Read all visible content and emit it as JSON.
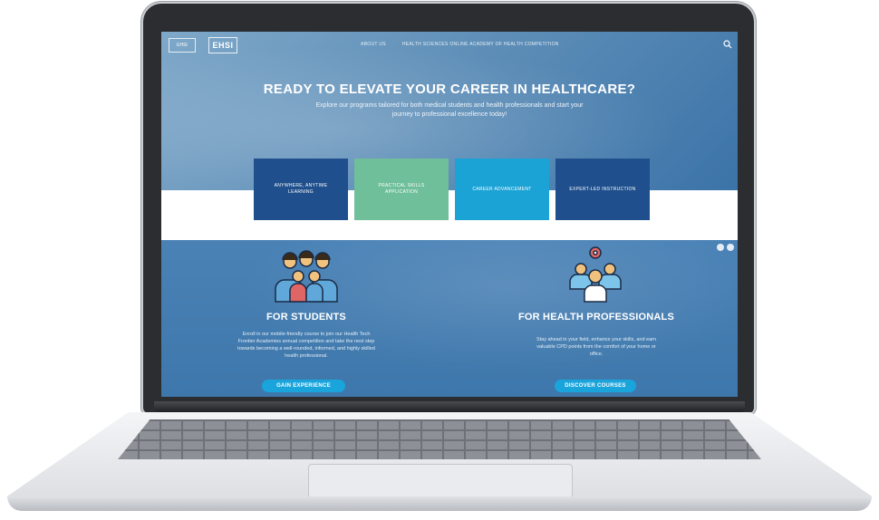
{
  "nav": {
    "logo_left": "EHSI",
    "logo_right": "EHSI",
    "links": [
      "ABOUT US",
      "HEALTH SCIENCES ONLINE ACADEMY OF HEALTH COMPETITION"
    ]
  },
  "hero": {
    "title": "READY TO ELEVATE YOUR CAREER IN HEALTHCARE?",
    "subtitle": "Explore our programs tailored for both medical students and health professionals and start your journey to professional excellence today!"
  },
  "tiles": [
    {
      "label": "ANYWHERE, ANYTIME LEARNING",
      "color": "#1f4f8c"
    },
    {
      "label": "PRACTICAL SKILLS APPLICATION",
      "color": "#6fbf9a"
    },
    {
      "label": "CAREER ADVANCEMENT",
      "color": "#1ba3d6"
    },
    {
      "label": "EXPERT-LED INSTRUCTION",
      "color": "#1f4f8c"
    }
  ],
  "students": {
    "title": "FOR STUDENTS",
    "text": "Enroll in our mobile-friendly course to join our Health Tech Frontier Academies annual competition and take the next step towards becoming a well-rounded, informed, and highly skilled health professional.",
    "button": "GAIN EXPERIENCE"
  },
  "professionals": {
    "title": "FOR HEALTH PROFESSIONALS",
    "text": "Stay ahead in your field, enhance your skills, and earn valuable CPD points from the comfort of your home or office.",
    "button": "DISCOVER COURSES"
  },
  "colors": {
    "accent": "#1aa4dc",
    "navy": "#1f4f8c",
    "teal": "#6fbf9a"
  }
}
